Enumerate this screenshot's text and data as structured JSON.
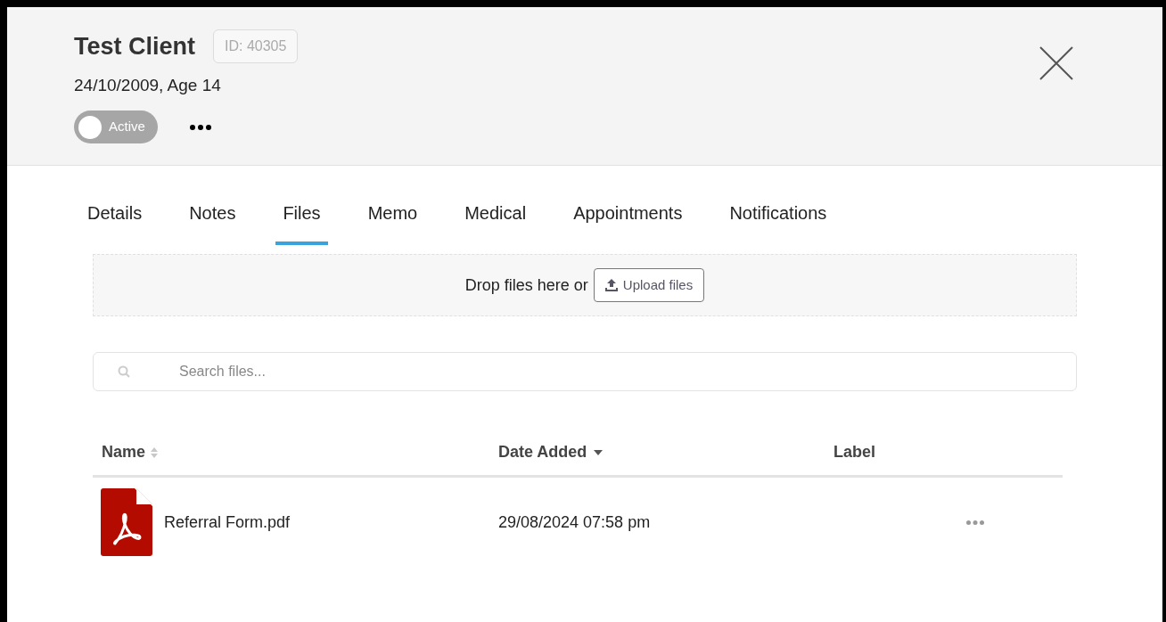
{
  "header": {
    "name": "Test Client",
    "id_badge": "ID: 40305",
    "subtitle": "24/10/2009, Age 14",
    "status_toggle": {
      "label": "Active",
      "on": false
    }
  },
  "tabs": [
    {
      "label": "Details",
      "selected": false
    },
    {
      "label": "Notes",
      "selected": false
    },
    {
      "label": "Files",
      "selected": true
    },
    {
      "label": "Memo",
      "selected": false
    },
    {
      "label": "Medical",
      "selected": false
    },
    {
      "label": "Appointments",
      "selected": false
    },
    {
      "label": "Notifications",
      "selected": false
    }
  ],
  "dropzone": {
    "text": "Drop files here or",
    "button": "Upload files"
  },
  "search": {
    "placeholder": "Search files..."
  },
  "table": {
    "columns": [
      {
        "label": "Name",
        "kind": "sortable"
      },
      {
        "label": "Date Added",
        "kind": "sorted"
      },
      {
        "label": "Label",
        "kind": "plain"
      }
    ],
    "rows": [
      {
        "kind": "pdf",
        "name": "Referral Form.pdf",
        "date": "29/08/2024 07:58 pm"
      }
    ]
  }
}
